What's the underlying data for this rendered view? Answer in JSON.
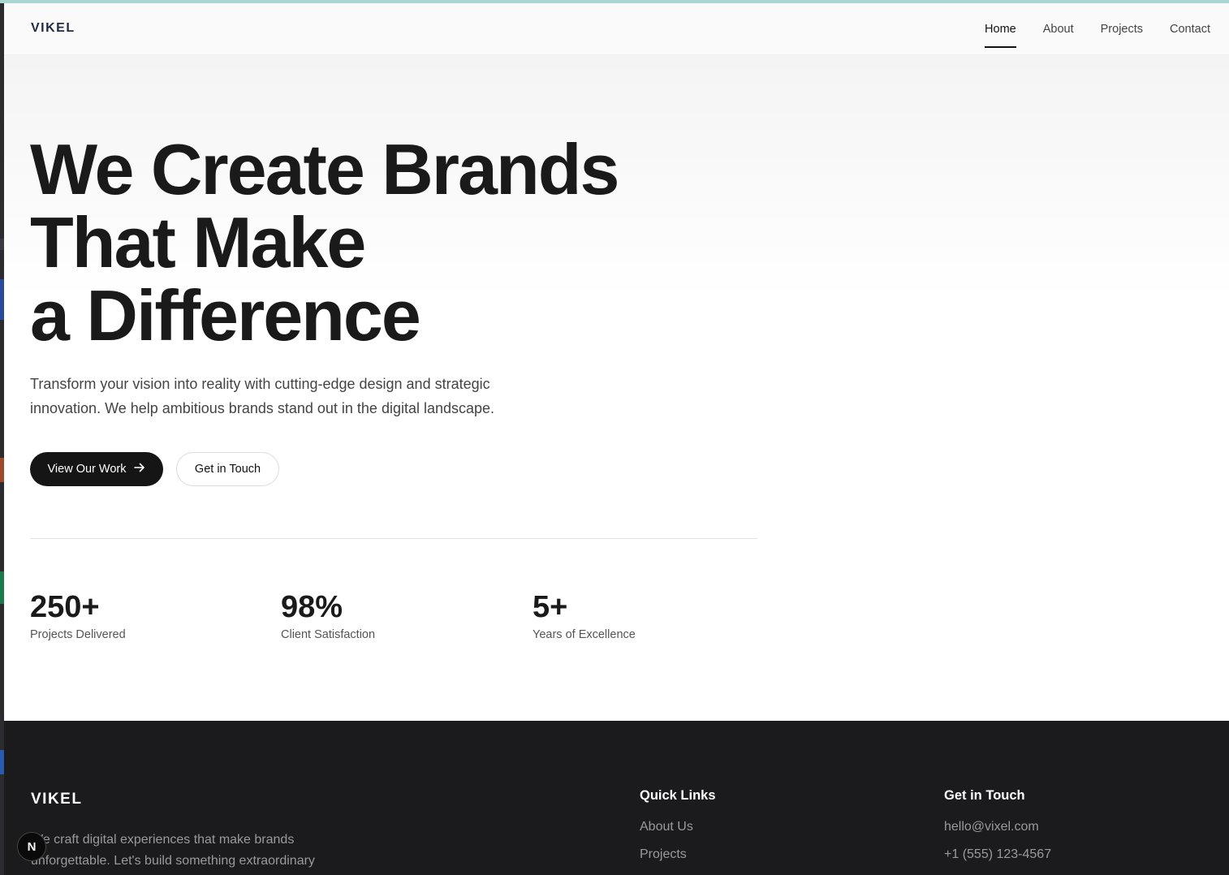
{
  "nav": {
    "logo": "VIKEL",
    "links": [
      "Home",
      "About",
      "Projects",
      "Contact"
    ],
    "active": "Home"
  },
  "hero": {
    "headline": [
      "We Create Brands",
      "That Make",
      "a Difference"
    ],
    "subtitle": "Transform your vision into reality with cutting-edge design and strategic innovation. We help ambitious brands stand out in the digital landscape.",
    "primary_button": "View Our Work",
    "primary_button_icon": "arrow-right-icon",
    "secondary_button": "Get in Touch"
  },
  "stats": [
    {
      "value": "250+",
      "label": "Projects Delivered"
    },
    {
      "value": "98%",
      "label": "Client Satisfaction"
    },
    {
      "value": "5+",
      "label": "Years of Excellence"
    }
  ],
  "footer": {
    "logo": "VIKEL",
    "description": "We craft digital experiences that make brands unforgettable. Let's build something extraordinary",
    "quick_links": {
      "heading": "Quick Links",
      "items": [
        "About Us",
        "Projects"
      ]
    },
    "contact": {
      "heading": "Get in Touch",
      "email": "hello@vixel.com",
      "phone": "+1 (555) 123-4567"
    }
  },
  "dev_badge": "N",
  "colors": {
    "accent_dark": "#151515",
    "footer_bg": "#1b1b1d",
    "top_strip": "#a9d6d3"
  }
}
